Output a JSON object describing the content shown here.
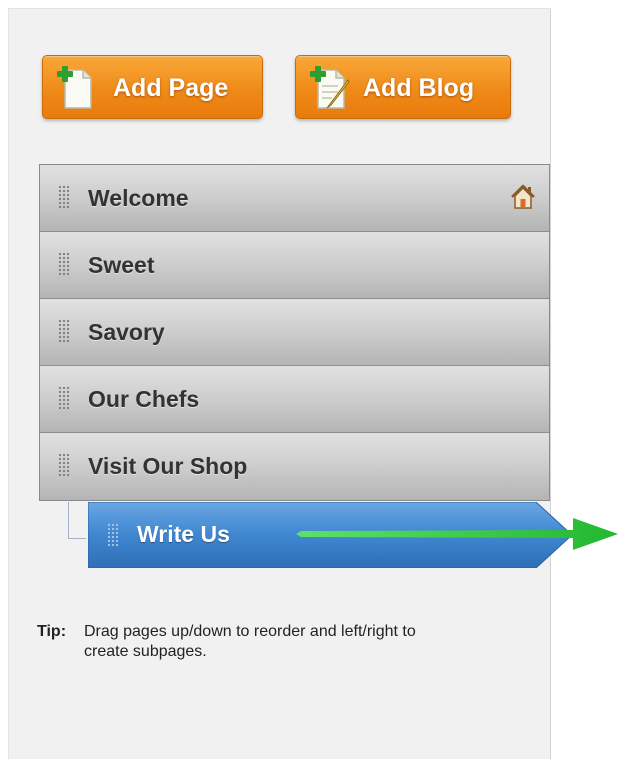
{
  "toolbar": {
    "add_page_label": "Add Page",
    "add_page_icon": "new-page-icon",
    "add_blog_label": "Add Blog",
    "add_blog_icon": "new-blog-icon"
  },
  "pages": [
    {
      "label": "Welcome",
      "is_home": true,
      "home_icon": "home-icon"
    },
    {
      "label": "Sweet"
    },
    {
      "label": "Savory"
    },
    {
      "label": "Our Chefs"
    },
    {
      "label": "Visit Our Shop"
    }
  ],
  "subpage": {
    "label": "Write Us",
    "parent": "Visit Our Shop",
    "state": "dragging"
  },
  "tip": {
    "label": "Tip:",
    "text": "Drag pages up/down to reorder and left/right to create subpages."
  },
  "colors": {
    "button_orange": "#f08a17",
    "row_gray": "#cdcdcd",
    "subpage_blue": "#3f87d1",
    "arrow_green": "#2fcb3a"
  }
}
